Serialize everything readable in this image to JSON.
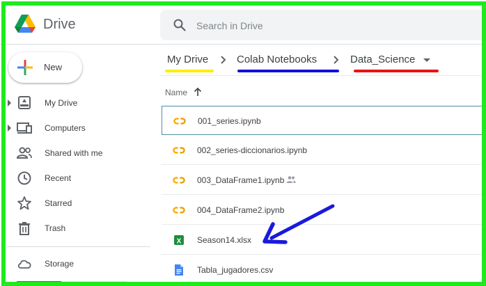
{
  "app": {
    "name": "Drive",
    "logo_icon": "google-drive-logo-icon"
  },
  "search": {
    "placeholder": "Search in Drive",
    "value": "",
    "icon": "search-icon"
  },
  "new_button": {
    "label": "New",
    "icon": "plus-icon"
  },
  "sidebar": {
    "items": [
      {
        "label": "My Drive",
        "icon": "my-drive-icon",
        "expandable": true
      },
      {
        "label": "Computers",
        "icon": "computers-icon",
        "expandable": true
      },
      {
        "label": "Shared with me",
        "icon": "shared-with-me-icon",
        "expandable": false
      },
      {
        "label": "Recent",
        "icon": "clock-icon",
        "expandable": false
      },
      {
        "label": "Starred",
        "icon": "star-icon",
        "expandable": false
      },
      {
        "label": "Trash",
        "icon": "trash-icon",
        "expandable": false
      },
      {
        "label": "Storage",
        "icon": "cloud-icon",
        "expandable": false
      }
    ]
  },
  "breadcrumb": {
    "items": [
      {
        "label": "My Drive",
        "underline_color": "#ffee00"
      },
      {
        "label": "Colab Notebooks",
        "underline_color": "#1010e0"
      },
      {
        "label": "Data_Science",
        "underline_color": "#ee1111"
      }
    ],
    "separator_icon": "chevron-right-icon",
    "dropdown_icon": "caret-down-icon"
  },
  "file_list": {
    "column_header": "Name",
    "sort_icon": "arrow-up-icon",
    "files": [
      {
        "name": "001_series.ipynb",
        "type": "colab",
        "selected": true,
        "shared": false
      },
      {
        "name": "002_series-diccionarios.ipynb",
        "type": "colab",
        "selected": false,
        "shared": false
      },
      {
        "name": "003_DataFrame1.ipynb",
        "type": "colab",
        "selected": false,
        "shared": true
      },
      {
        "name": "004_DataFrame2.ipynb",
        "type": "colab",
        "selected": false,
        "shared": false
      },
      {
        "name": "Season14.xlsx",
        "type": "excel",
        "selected": false,
        "shared": false
      },
      {
        "name": "Tabla_jugadores.csv",
        "type": "doc",
        "selected": false,
        "shared": false
      }
    ]
  },
  "colors": {
    "frame": "#1eea1e",
    "annotation_arrow": "#1a1adc",
    "colab_orange": "#f9ab00",
    "excel_green": "#1e8e3e",
    "doc_blue": "#4285f4"
  }
}
